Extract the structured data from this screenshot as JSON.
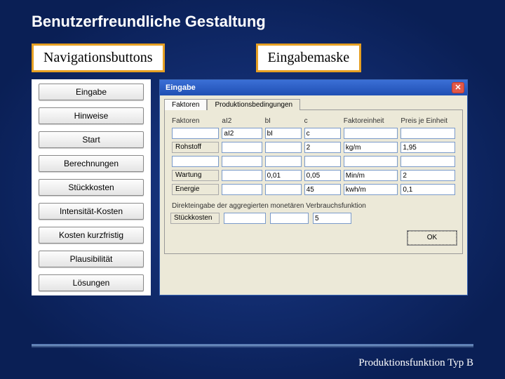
{
  "title": "Benutzerfreundliche Gestaltung",
  "labels": {
    "nav": "Navigationsbuttons",
    "form": "Eingabemaske"
  },
  "nav": {
    "items": [
      "Eingabe",
      "Hinweise",
      "Start",
      "Berechnungen",
      "Stückkosten",
      "Intensität-Kosten",
      "Kosten kurzfristig",
      "Plausibilität",
      "Lösungen"
    ]
  },
  "dialog": {
    "title": "Eingabe",
    "tabs": [
      "Faktoren",
      "Produktionsbedingungen"
    ],
    "headers": {
      "faktoren": "Faktoren",
      "aI2": "aI2",
      "bI": "bI",
      "c": "c",
      "einheit": "Faktoreinheit",
      "preis": "Preis je Einheit"
    },
    "rows": [
      {
        "label": "",
        "aI2": "aI2",
        "bI": "bI",
        "c": "c",
        "einheit": "",
        "preis": ""
      },
      {
        "label": "Rohstoff",
        "aI2": "",
        "bI": "",
        "c": "2",
        "einheit": "kg/m",
        "preis": "1,95"
      },
      {
        "label": "",
        "aI2": "",
        "bI": "",
        "c": "",
        "einheit": "",
        "preis": ""
      },
      {
        "label": "Wartung",
        "aI2": "",
        "bI": "0,01",
        "c": "0,05",
        "einheit": "Min/m",
        "preis": "2"
      },
      {
        "label": "Energie",
        "aI2": "",
        "bI": "",
        "c": "45",
        "einheit": "kwh/m",
        "preis": "0,1"
      }
    ],
    "direct_label": "Direkteingabe der aggregierten monetären Verbrauchsfunktion",
    "stueckkosten_label": "Stückkosten",
    "stueckkosten": {
      "a": "",
      "b": "",
      "c": "5"
    },
    "ok": "OK"
  },
  "footer": "Produktionsfunktion Typ B"
}
